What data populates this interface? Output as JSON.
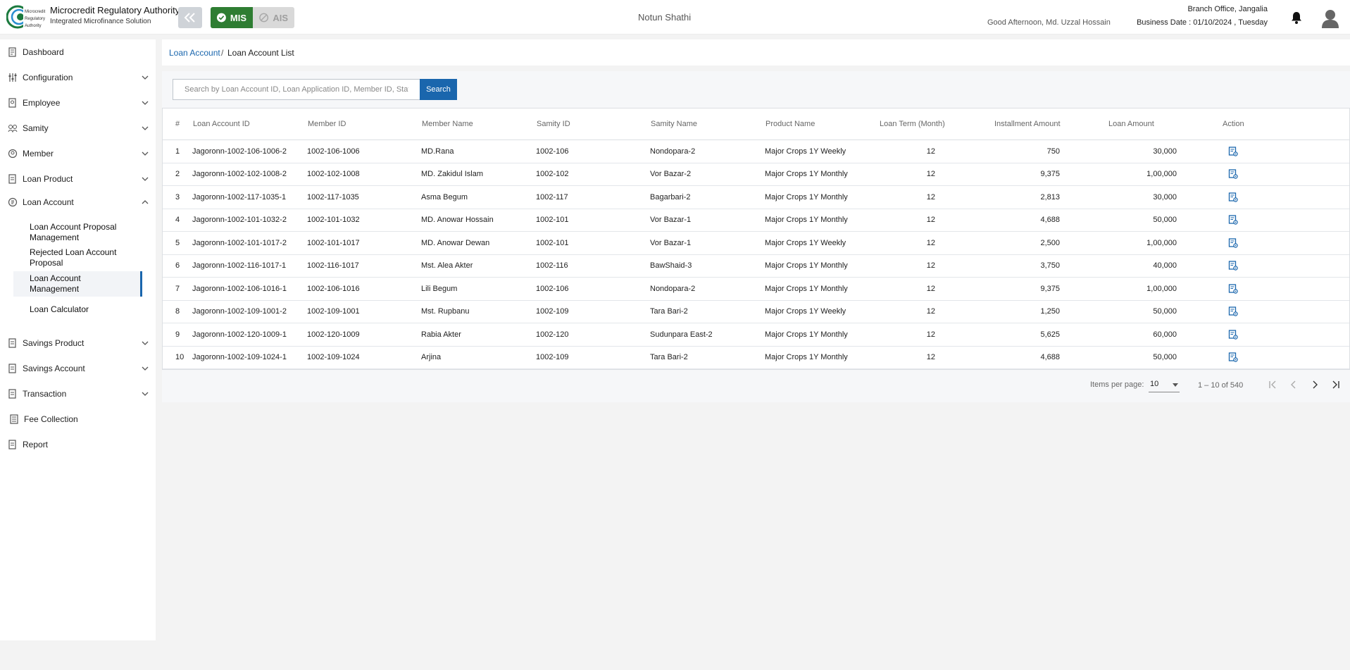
{
  "header": {
    "brand_title": "Microcredit Regulatory Authority",
    "brand_subtitle": "Integrated Microfinance Solution",
    "logo_text_1": "Microcredit",
    "logo_text_2": "Regulatory",
    "logo_text_3": "Authority",
    "mode_mis": "MIS",
    "mode_ais": "AIS",
    "center_title": "Notun Shathi",
    "greeting": "Good Afternoon, Md. Uzzal Hossain",
    "branch": "Branch Office, Jangalia",
    "business_date": "Business Date : 01/10/2024 , Tuesday"
  },
  "sidebar": {
    "items": [
      {
        "label": "Dashboard",
        "icon": "dashboard-icon"
      },
      {
        "label": "Configuration",
        "icon": "config-icon"
      },
      {
        "label": "Employee",
        "icon": "employee-icon"
      },
      {
        "label": "Samity",
        "icon": "samity-icon"
      },
      {
        "label": "Member",
        "icon": "member-icon"
      },
      {
        "label": "Loan Product",
        "icon": "loan-product-icon"
      },
      {
        "label": "Loan Account",
        "icon": "loan-account-icon"
      },
      {
        "label": "Savings Product",
        "icon": "savings-product-icon"
      },
      {
        "label": "Savings Account",
        "icon": "savings-account-icon"
      },
      {
        "label": "Transaction",
        "icon": "transaction-icon"
      },
      {
        "label": "Fee Collection",
        "icon": "fee-collection-icon"
      },
      {
        "label": "Report",
        "icon": "report-icon"
      }
    ],
    "sub_items": [
      {
        "line1": "Loan Account Proposal",
        "line2": "Management"
      },
      {
        "line1": "Rejected Loan Account",
        "line2": "Proposal"
      },
      {
        "line1": "Loan Account",
        "line2": "Management"
      },
      {
        "line1": "Loan Calculator",
        "line2": ""
      }
    ]
  },
  "breadcrumb": {
    "link": "Loan Account",
    "separator": "/",
    "current": "Loan Account List"
  },
  "search": {
    "placeholder": "Search by Loan Account ID, Loan Application ID, Member ID, Status...",
    "button": "Search"
  },
  "table": {
    "headers": [
      "#",
      "Loan Account ID",
      "Member ID",
      "Member Name",
      "Samity ID",
      "Samity Name",
      "Product Name",
      "Loan Term (Month)",
      "Installment Amount",
      "Loan Amount",
      "Action"
    ],
    "rows": [
      {
        "n": "1",
        "loan_id": "Jagoronn-1002-106-1006-2",
        "member_id": "1002-106-1006",
        "member_name": "MD.Rana",
        "samity_id": "1002-106",
        "samity_name": "Nondopara-2",
        "product": "Major Crops 1Y Weekly",
        "term": "12",
        "installment": "750",
        "amount": "30,000"
      },
      {
        "n": "2",
        "loan_id": "Jagoronn-1002-102-1008-2",
        "member_id": "1002-102-1008",
        "member_name": "MD. Zakidul Islam",
        "samity_id": "1002-102",
        "samity_name": "Vor Bazar-2",
        "product": "Major Crops 1Y Monthly",
        "term": "12",
        "installment": "9,375",
        "amount": "1,00,000"
      },
      {
        "n": "3",
        "loan_id": "Jagoronn-1002-117-1035-1",
        "member_id": "1002-117-1035",
        "member_name": "Asma Begum",
        "samity_id": "1002-117",
        "samity_name": "Bagarbari-2",
        "product": "Major Crops 1Y Monthly",
        "term": "12",
        "installment": "2,813",
        "amount": "30,000"
      },
      {
        "n": "4",
        "loan_id": "Jagoronn-1002-101-1032-2",
        "member_id": "1002-101-1032",
        "member_name": "MD. Anowar Hossain",
        "samity_id": "1002-101",
        "samity_name": "Vor Bazar-1",
        "product": "Major Crops 1Y Monthly",
        "term": "12",
        "installment": "4,688",
        "amount": "50,000"
      },
      {
        "n": "5",
        "loan_id": "Jagoronn-1002-101-1017-2",
        "member_id": "1002-101-1017",
        "member_name": "MD. Anowar Dewan",
        "samity_id": "1002-101",
        "samity_name": "Vor Bazar-1",
        "product": "Major Crops 1Y Weekly",
        "term": "12",
        "installment": "2,500",
        "amount": "1,00,000"
      },
      {
        "n": "6",
        "loan_id": "Jagoronn-1002-116-1017-1",
        "member_id": "1002-116-1017",
        "member_name": "Mst. Alea Akter",
        "samity_id": "1002-116",
        "samity_name": "BawShaid-3",
        "product": "Major Crops 1Y Monthly",
        "term": "12",
        "installment": "3,750",
        "amount": "40,000"
      },
      {
        "n": "7",
        "loan_id": "Jagoronn-1002-106-1016-1",
        "member_id": "1002-106-1016",
        "member_name": "Lili Begum",
        "samity_id": "1002-106",
        "samity_name": "Nondopara-2",
        "product": "Major Crops 1Y Monthly",
        "term": "12",
        "installment": "9,375",
        "amount": "1,00,000"
      },
      {
        "n": "8",
        "loan_id": "Jagoronn-1002-109-1001-2",
        "member_id": "1002-109-1001",
        "member_name": "Mst. Rupbanu",
        "samity_id": "1002-109",
        "samity_name": "Tara Bari-2",
        "product": "Major Crops 1Y Weekly",
        "term": "12",
        "installment": "1,250",
        "amount": "50,000"
      },
      {
        "n": "9",
        "loan_id": "Jagoronn-1002-120-1009-1",
        "member_id": "1002-120-1009",
        "member_name": "Rabia Akter",
        "samity_id": "1002-120",
        "samity_name": "Sudunpara East-2",
        "product": "Major Crops 1Y Monthly",
        "term": "12",
        "installment": "5,625",
        "amount": "60,000"
      },
      {
        "n": "10",
        "loan_id": "Jagoronn-1002-109-1024-1",
        "member_id": "1002-109-1024",
        "member_name": "Arjina",
        "samity_id": "1002-109",
        "samity_name": "Tara Bari-2",
        "product": "Major Crops 1Y Monthly",
        "term": "12",
        "installment": "4,688",
        "amount": "50,000"
      }
    ]
  },
  "pagination": {
    "items_per_page_label": "Items per page:",
    "items_per_page": "10",
    "range": "1 – 10 of 540"
  },
  "colors": {
    "primary": "#1a66ad",
    "mis_active": "#2e7d32"
  }
}
